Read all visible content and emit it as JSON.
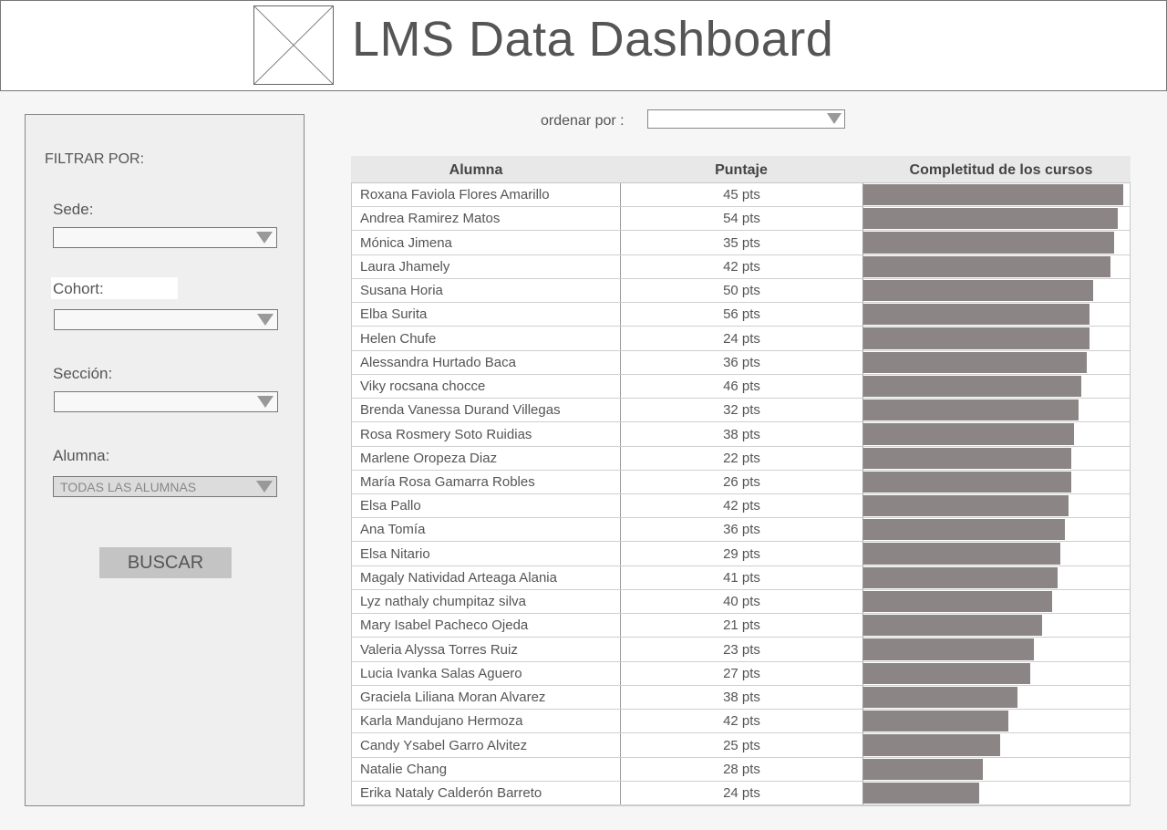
{
  "header": {
    "title": "LMS Data Dashboard",
    "logo_icon": "image-placeholder-icon"
  },
  "sidebar": {
    "filter_title": "FILTRAR POR:",
    "sede": {
      "label": "Sede:",
      "value": ""
    },
    "cohort": {
      "label": "Cohort:",
      "value": ""
    },
    "seccion": {
      "label": "Sección:",
      "value": ""
    },
    "alumna": {
      "label": "Alumna:",
      "value": "TODAS LAS ALUMNAS"
    },
    "search_button": "BUSCAR"
  },
  "sort": {
    "label": "ordenar por :",
    "value": ""
  },
  "table": {
    "columns": [
      "Alumna",
      "Puntaje",
      "Completitud de los cursos"
    ],
    "bar_color": "#8b8585",
    "rows": [
      {
        "name": "Roxana Faviola Flores Amarillo",
        "points": "45 pts",
        "completion": 0.979
      },
      {
        "name": "Andrea Ramirez Matos",
        "points": "54 pts",
        "completion": 0.959
      },
      {
        "name": "Mónica Jimena",
        "points": "35 pts",
        "completion": 0.945
      },
      {
        "name": "Laura Jhamely",
        "points": "42 pts",
        "completion": 0.932
      },
      {
        "name": "Susana Horia",
        "points": "50 pts",
        "completion": 0.866
      },
      {
        "name": "Elba Surita",
        "points": "56 pts",
        "completion": 0.852
      },
      {
        "name": "Helen Chufe",
        "points": "24 pts",
        "completion": 0.852
      },
      {
        "name": "Alessandra Hurtado Baca",
        "points": "36 pts",
        "completion": 0.842
      },
      {
        "name": "Viky rocsana chocce",
        "points": "46 pts",
        "completion": 0.822
      },
      {
        "name": "Brenda Vanessa Durand Villegas",
        "points": "32 pts",
        "completion": 0.811
      },
      {
        "name": "Rosa Rosmery Soto Ruidias",
        "points": "38 pts",
        "completion": 0.795
      },
      {
        "name": "Marlene Oropeza Diaz",
        "points": "22 pts",
        "completion": 0.785
      },
      {
        "name": "María Rosa Gamarra Robles",
        "points": "26 pts",
        "completion": 0.785
      },
      {
        "name": "Elsa Pallo",
        "points": "42 pts",
        "completion": 0.772
      },
      {
        "name": "Ana Tomía",
        "points": "36 pts",
        "completion": 0.758
      },
      {
        "name": "Elsa Nitario",
        "points": "29 pts",
        "completion": 0.741
      },
      {
        "name": "Magaly Natividad Arteaga Alania",
        "points": "41 pts",
        "completion": 0.731
      },
      {
        "name": "Lyz nathaly chumpitaz silva",
        "points": "40 pts",
        "completion": 0.712
      },
      {
        "name": "Mary Isabel Pacheco Ojeda",
        "points": "21 pts",
        "completion": 0.675
      },
      {
        "name": "Valeria Alyssa Torres Ruiz",
        "points": "23 pts",
        "completion": 0.641
      },
      {
        "name": "Lucia Ivanka Salas Aguero",
        "points": "27 pts",
        "completion": 0.628
      },
      {
        "name": "Graciela Liliana Moran Alvarez",
        "points": "38 pts",
        "completion": 0.58
      },
      {
        "name": "Karla Mandujano Hermoza",
        "points": "42 pts",
        "completion": 0.546
      },
      {
        "name": "Candy Ysabel Garro Alvitez",
        "points": "25 pts",
        "completion": 0.515
      },
      {
        "name": "Natalie Chang",
        "points": "28 pts",
        "completion": 0.451
      },
      {
        "name": "Erika Nataly Calderón Barreto",
        "points": "24 pts",
        "completion": 0.437
      }
    ]
  }
}
